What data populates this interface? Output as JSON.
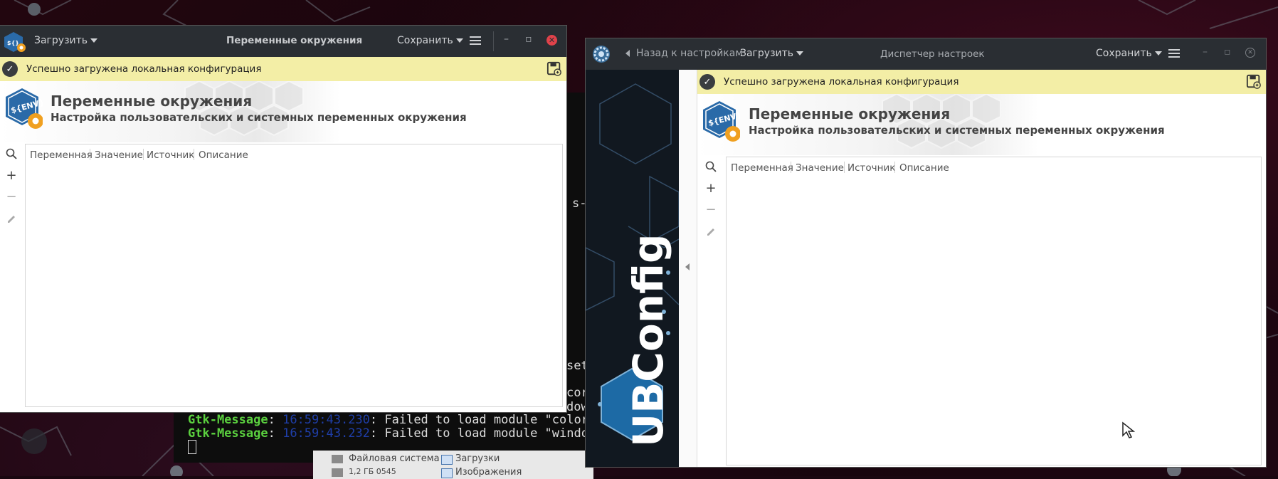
{
  "terminal": {
    "fragment_1": "s-e",
    "fragment_2": "set",
    "fragment_3": "corr",
    "fragment_4": "dow",
    "lines": [
      {
        "tag": "Gtk-Message",
        "time": "16:59:43.230",
        "text": ": Failed to load module \"colorr"
      },
      {
        "tag": "Gtk-Message",
        "time": "16:59:43.232",
        "text": ": Failed to load module \"window"
      }
    ]
  },
  "file_manager": {
    "item1": "Файловая система",
    "item2": "Загрузки",
    "item3": "Изображения",
    "item4": "1,2 ГБ  0545"
  },
  "left_window": {
    "load_label": "Загрузить",
    "title": "Переменные окружения",
    "save_label": "Сохранить",
    "info_text": "Успешно загружена локальная конфигурация",
    "header_title": "Переменные окружения",
    "header_sub": "Настройка пользовательских и системных переменных окружения",
    "columns": [
      "Переменная",
      "Значение",
      "Источник",
      "Описание"
    ]
  },
  "right_window": {
    "back_label": "Назад к настройкам",
    "load_label": "Загрузить",
    "title": "Диспетчер настроек",
    "save_label": "Сохранить",
    "sidebar_logo": "UBConfig",
    "info_text": "Успешно загружена локальная конфигурация",
    "header_title": "Переменные окружения",
    "header_sub": "Настройка пользовательских и системных переменных окружения",
    "columns": [
      "Переменная",
      "Значение",
      "Источник",
      "Описание"
    ]
  },
  "icons": {
    "env_badge": "${ENV}"
  },
  "colors": {
    "titlebar": "#2a2e33",
    "infobar": "#f3eea6",
    "close": "#e0424a",
    "accent_orange": "#f0a020",
    "logo_blue": "#2a6aa8"
  }
}
